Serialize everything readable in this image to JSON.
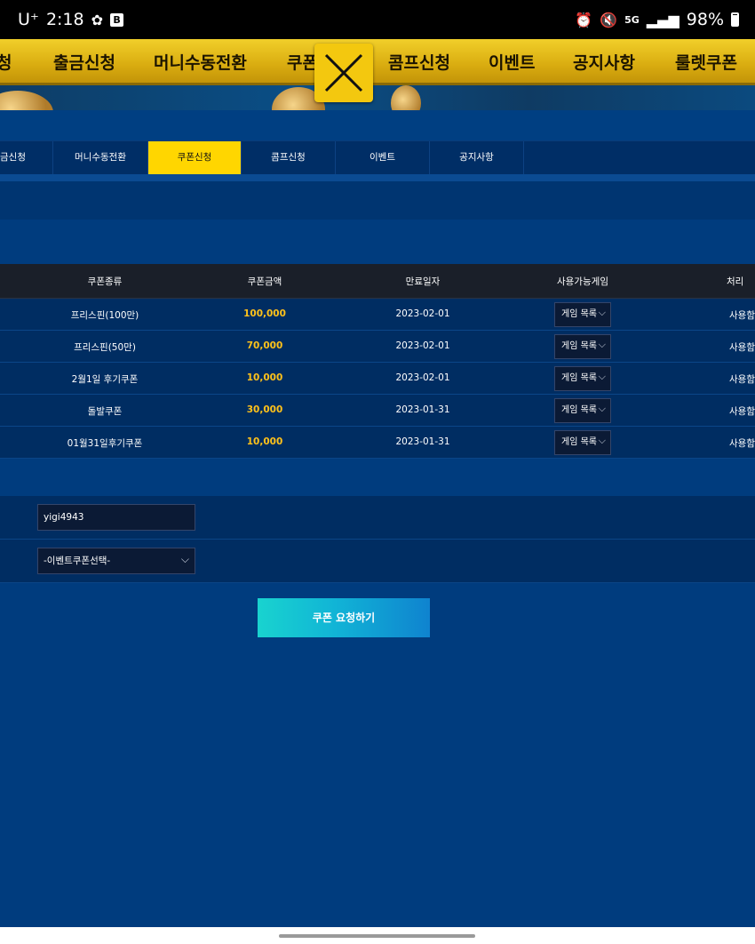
{
  "status_bar": {
    "carrier": "U⁺",
    "time": "2:18",
    "network": "5G",
    "battery": "98%"
  },
  "top_menu": [
    "청",
    "출금신청",
    "머니수동전환",
    "쿠폰",
    "콤프신청",
    "이벤트",
    "공지사항",
    "룰렛쿠폰"
  ],
  "sub_tabs": [
    "금신청",
    "머니수동전환",
    "쿠폰신청",
    "콤프신청",
    "이벤트",
    "공지사항"
  ],
  "table": {
    "headers": [
      "쿠폰종류",
      "쿠폰금액",
      "만료일자",
      "사용가능게임",
      "처리"
    ],
    "rows": [
      {
        "type": "프리스핀(100만)",
        "amount": "100,000",
        "expiry": "2023-02-01",
        "game": "게임 목록",
        "action": "사용함"
      },
      {
        "type": "프리스핀(50만)",
        "amount": "70,000",
        "expiry": "2023-02-01",
        "game": "게임 목록",
        "action": "사용함"
      },
      {
        "type": "2월1일 후기쿠폰",
        "amount": "10,000",
        "expiry": "2023-02-01",
        "game": "게임 목록",
        "action": "사용함"
      },
      {
        "type": "돌발쿠폰",
        "amount": "30,000",
        "expiry": "2023-01-31",
        "game": "게임 목록",
        "action": "사용함"
      },
      {
        "type": "01월31일후기쿠폰",
        "amount": "10,000",
        "expiry": "2023-01-31",
        "game": "게임 목록",
        "action": "사용함"
      }
    ]
  },
  "form": {
    "username": "yigi4943",
    "coupon_select": "-이벤트쿠폰선택-"
  },
  "submit_label": "쿠폰 요청하기",
  "colors": {
    "page_bg": "#003c7e",
    "gold_menu": "#e0b416",
    "active_tab": "#ffd600",
    "amount": "#ffc21a",
    "button_start": "#19d3cf",
    "button_end": "#0f83cf"
  }
}
